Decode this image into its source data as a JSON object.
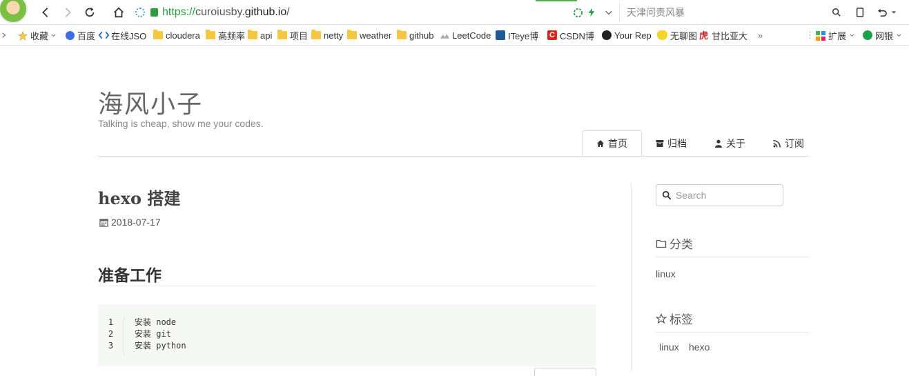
{
  "browser": {
    "url_scheme": "https://",
    "url_host_prefix": "curoiusby.",
    "url_host": "github.io",
    "url_path": "/",
    "search_placeholder": "天津问责风暴"
  },
  "bookmarks": [
    {
      "label": "收藏",
      "icon": "star-icon"
    },
    {
      "label": "百度",
      "icon": "baidu-icon"
    },
    {
      "label": "在线JSO",
      "icon": "json-icon"
    },
    {
      "label": "cloudera",
      "icon": "folder-icon"
    },
    {
      "label": "高频率",
      "icon": "folder-icon"
    },
    {
      "label": "api",
      "icon": "folder-icon"
    },
    {
      "label": "项目",
      "icon": "folder-icon"
    },
    {
      "label": "netty",
      "icon": "folder-icon"
    },
    {
      "label": "weather",
      "icon": "folder-icon"
    },
    {
      "label": "github",
      "icon": "folder-icon"
    },
    {
      "label": "LeetCode",
      "icon": "leetcode-icon"
    },
    {
      "label": "ITeye博",
      "icon": "iteye-icon"
    },
    {
      "label": "CSDN博",
      "icon": "csdn-icon"
    },
    {
      "label": "Your Rep",
      "icon": "github-icon"
    },
    {
      "label": "无聊图",
      "icon": "face-icon"
    },
    {
      "label": "甘比亚大",
      "icon": "tiger-icon"
    },
    {
      "label": "»",
      "icon": "more-icon"
    },
    {
      "label": "扩展",
      "icon": "extensions-icon"
    },
    {
      "label": "网银",
      "icon": "bank-icon"
    }
  ],
  "site": {
    "title": "海风小子",
    "subtitle": "Talking is cheap, show me your codes."
  },
  "nav": [
    {
      "label": "首页",
      "icon": "home-icon"
    },
    {
      "label": "归档",
      "icon": "archive-icon"
    },
    {
      "label": "关于",
      "icon": "user-icon"
    },
    {
      "label": "订阅",
      "icon": "rss-icon"
    }
  ],
  "post": {
    "title": "hexo 搭建",
    "date": "2018-07-17",
    "section_heading": "准备工作",
    "code_lines": [
      {
        "num": "1",
        "text": "安装 node"
      },
      {
        "num": "2",
        "text": "安装 git"
      },
      {
        "num": "3",
        "text": "安装 python"
      }
    ]
  },
  "sidebar": {
    "search_placeholder": "Search",
    "categories_heading": "分类",
    "categories": [
      "linux"
    ],
    "tags_heading": "标签",
    "tags": [
      "linux",
      "hexo"
    ]
  }
}
